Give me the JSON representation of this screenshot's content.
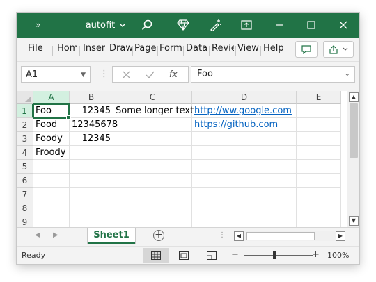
{
  "window": {
    "title": "autofit",
    "title_chevron": "⌵",
    "expand_glyph": "»"
  },
  "ribbon": {
    "tabs": [
      "File",
      "Hom",
      "Inser",
      "Draw",
      "Page",
      "Form",
      "Data",
      "Revie",
      "View",
      "Help"
    ]
  },
  "formula_bar": {
    "name_box": "A1",
    "fx_label": "fx",
    "formula_value": "Foo"
  },
  "sheet": {
    "columns": [
      "A",
      "B",
      "C",
      "D",
      "E"
    ],
    "selected_column": "A",
    "selected_row": "1",
    "rows": [
      {
        "num": "1",
        "cells": [
          "Foo",
          "12345",
          "Some longer text",
          "http://ww.google.com",
          ""
        ]
      },
      {
        "num": "2",
        "cells": [
          "Food",
          "12345678",
          "",
          "https://github.com",
          ""
        ]
      },
      {
        "num": "3",
        "cells": [
          "Foody",
          "12345",
          "",
          "",
          ""
        ]
      },
      {
        "num": "4",
        "cells": [
          "Froody",
          "",
          "",
          "",
          ""
        ]
      },
      {
        "num": "5",
        "cells": [
          "",
          "",
          "",
          "",
          ""
        ]
      },
      {
        "num": "6",
        "cells": [
          "",
          "",
          "",
          "",
          ""
        ]
      },
      {
        "num": "7",
        "cells": [
          "",
          "",
          "",
          "",
          ""
        ]
      },
      {
        "num": "8",
        "cells": [
          "",
          "",
          "",
          "",
          ""
        ]
      },
      {
        "num": "9",
        "cells": [
          "",
          "",
          "",
          "",
          ""
        ]
      }
    ]
  },
  "sheet_tabs": {
    "active": "Sheet1"
  },
  "status_bar": {
    "status": "Ready",
    "zoom": "100%",
    "zoom_minus": "−",
    "zoom_plus": "+"
  },
  "colors": {
    "title_bar": "#217346",
    "accent": "#217346",
    "link": "#0563c1"
  }
}
